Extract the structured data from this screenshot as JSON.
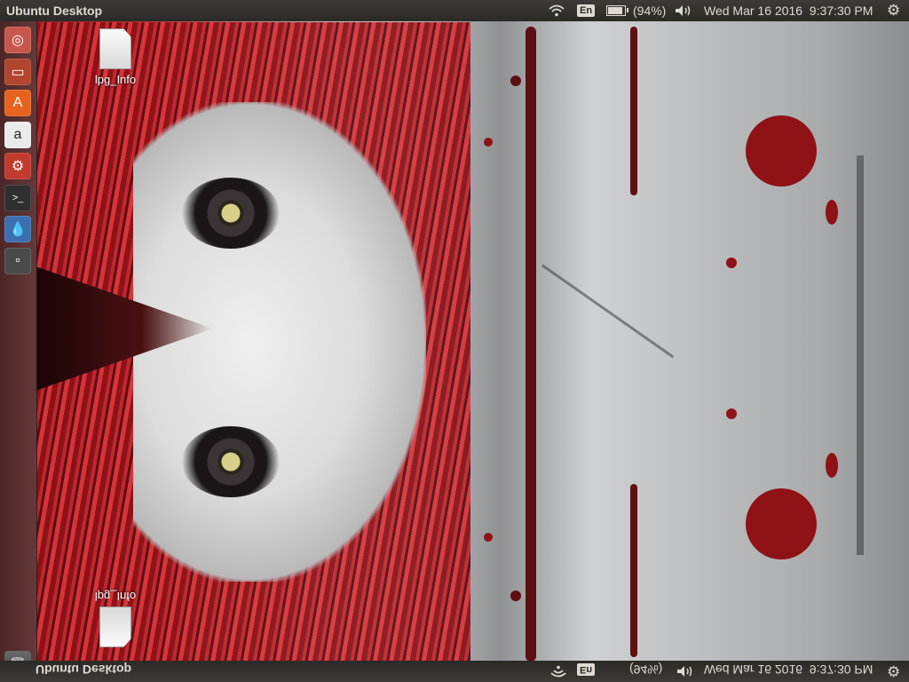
{
  "top_panel": {
    "title": "Ubuntu Desktop",
    "wifi_icon": "wifi-icon",
    "input_method": "En",
    "battery_percent": "(94%)",
    "battery_level": 0.94,
    "volume_icon": "volume-icon",
    "datetime": "Wed Mar 16 2016  9:37:30 PM",
    "settings_icon": "gear-icon"
  },
  "launcher": {
    "items": [
      {
        "name": "ubuntu-dash-icon",
        "glyph": "◎",
        "color": "#c7564c"
      },
      {
        "name": "files-icon",
        "glyph": "▭",
        "color": "#b2452d"
      },
      {
        "name": "software-center-icon",
        "glyph": "A",
        "color": "#e5631e"
      },
      {
        "name": "amazon-icon",
        "glyph": "a",
        "color": "#eaeaea"
      },
      {
        "name": "system-settings-icon",
        "glyph": "⚙",
        "color": "#c33a2e"
      },
      {
        "name": "terminal-icon",
        "glyph": ">_",
        "color": "#2f2f2f"
      },
      {
        "name": "water-drop-icon",
        "glyph": "💧",
        "color": "#3b6fb0"
      },
      {
        "name": "unknown-app-icon",
        "glyph": "▫",
        "color": "#4a4a4a"
      }
    ],
    "trash_icon": "trash-icon"
  },
  "desktop": {
    "icon_label": "lpg_Info"
  },
  "mirrored_bottom": {
    "title": "Ubuntu Desktop",
    "input_method": "En",
    "battery_percent": "(94%)",
    "datetime": "Wed Mar 16 2016  9:37:30 PM",
    "icon_label": "lpg_Info"
  }
}
